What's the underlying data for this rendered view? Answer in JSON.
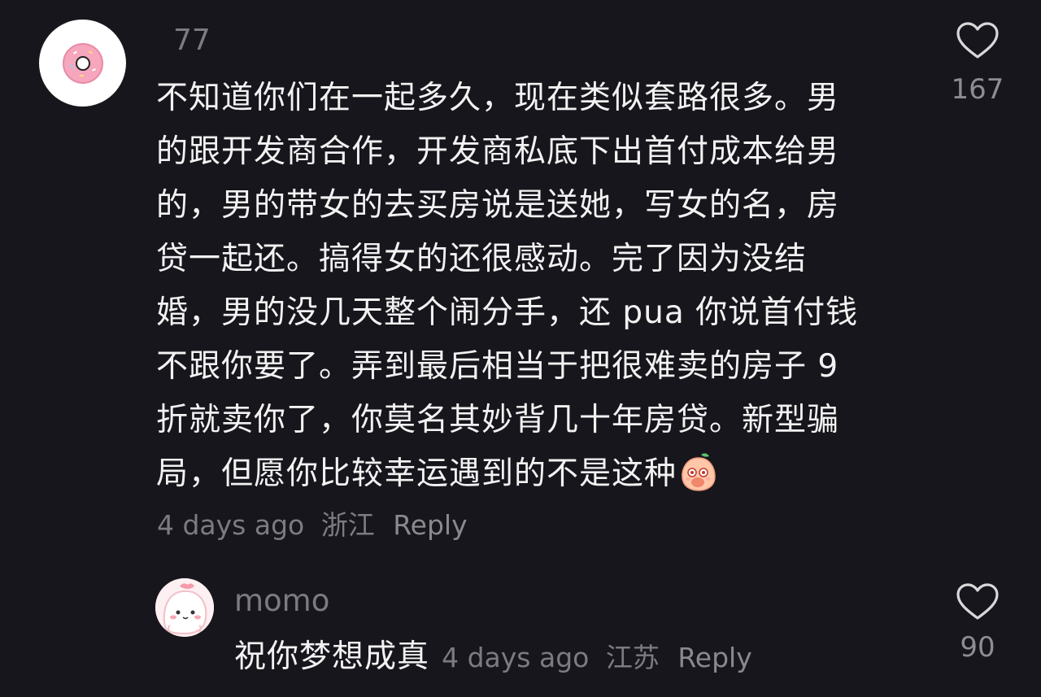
{
  "comment": {
    "username": "77",
    "text_lines": [
      "不知道你们在一起多久，现在类似套路很多。男",
      "的跟开发商合作，开发商私底下出首付成本给男",
      "的，男的带女的去买房说是送她，写女的名，房",
      "贷一起还。搞得女的还很感动。完了因为没结",
      "婚，男的没几天整个闹分手，还 pua 你说首付钱",
      "不跟你要了。弄到最后相当于把很难卖的房子 9",
      "折就卖你了，你莫名其妙背几十年房贷。新型骗",
      "局，但愿你比较幸运遇到的不是这种"
    ],
    "time": "4 days ago",
    "region": "浙江",
    "reply_label": "Reply",
    "likes": "167",
    "avatar_icon": "donut-icon",
    "sticker_icon": "peach-sticker-icon"
  },
  "reply": {
    "username": "momo",
    "text": "祝你梦想成真",
    "time": "4 days ago",
    "region": "江苏",
    "reply_label": "Reply",
    "likes": "90",
    "avatar_icon": "pink-blob-avatar-icon"
  },
  "colors": {
    "background": "#17161c",
    "text_primary": "#f2f2f2",
    "text_secondary": "#7c7b80",
    "heart_outline": "#d8d8da"
  }
}
